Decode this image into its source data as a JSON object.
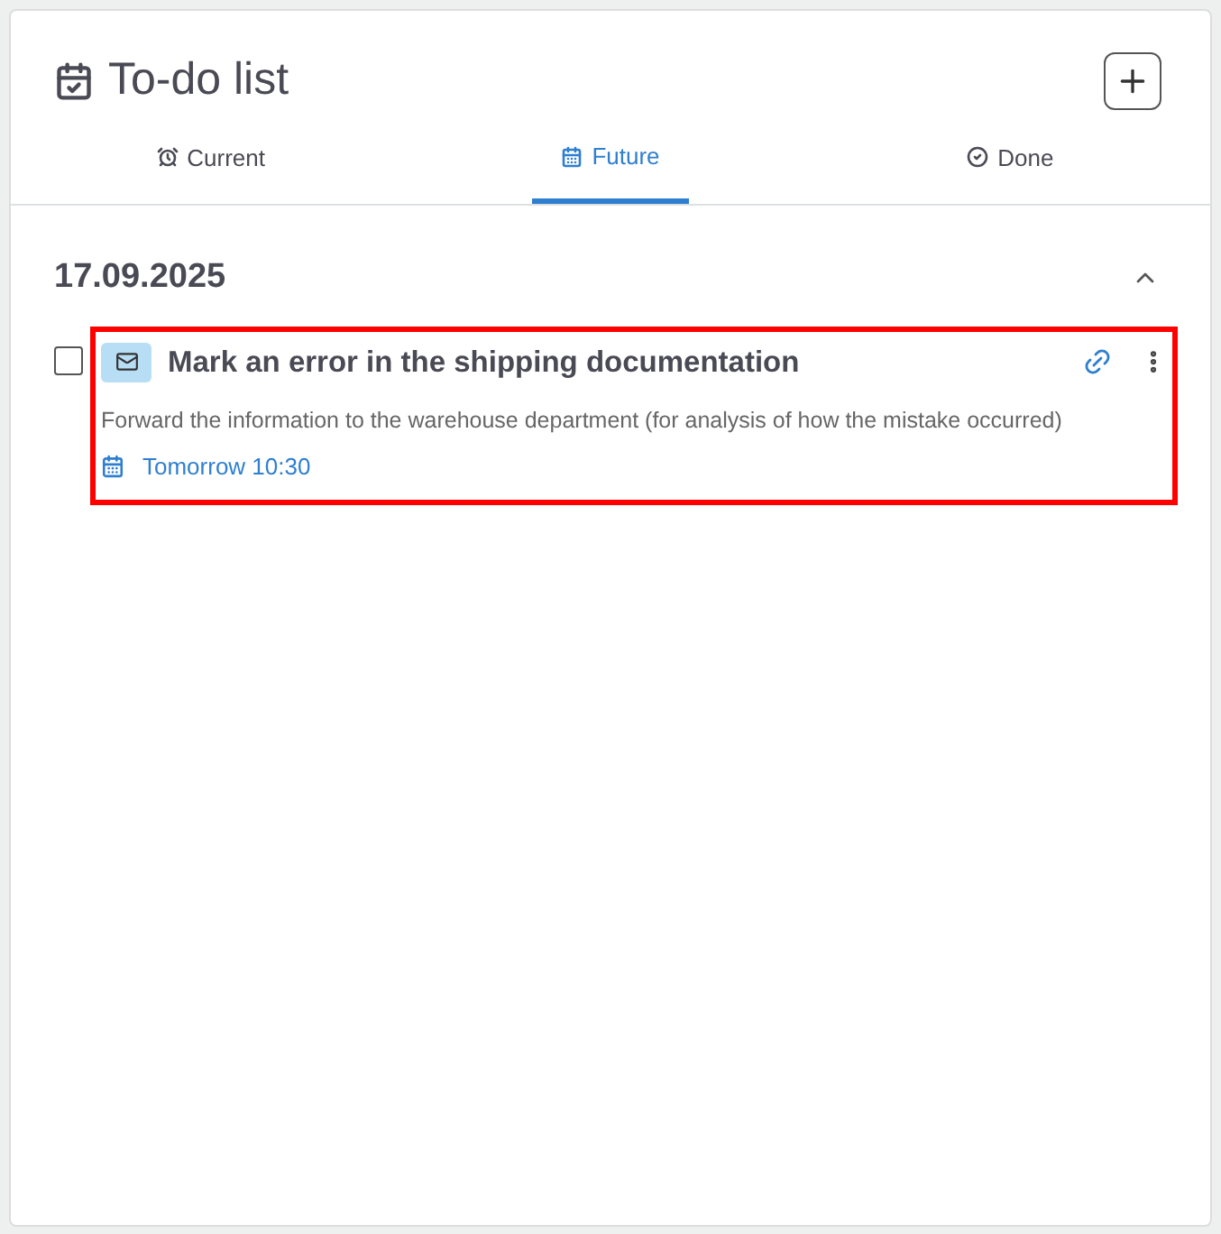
{
  "header": {
    "title": "To-do list"
  },
  "tabs": [
    {
      "label": "Current",
      "selected": false
    },
    {
      "label": "Future",
      "selected": true
    },
    {
      "label": "Done",
      "selected": false
    }
  ],
  "groups": [
    {
      "date": "17.09.2025",
      "expanded": true,
      "tasks": [
        {
          "title": "Mark an error in the shipping documentation",
          "description": "Forward the information to the warehouse department (for analysis of how the mistake occurred)",
          "due": "Tomorrow 10:30",
          "checked": false,
          "highlighted": true
        }
      ]
    }
  ]
}
